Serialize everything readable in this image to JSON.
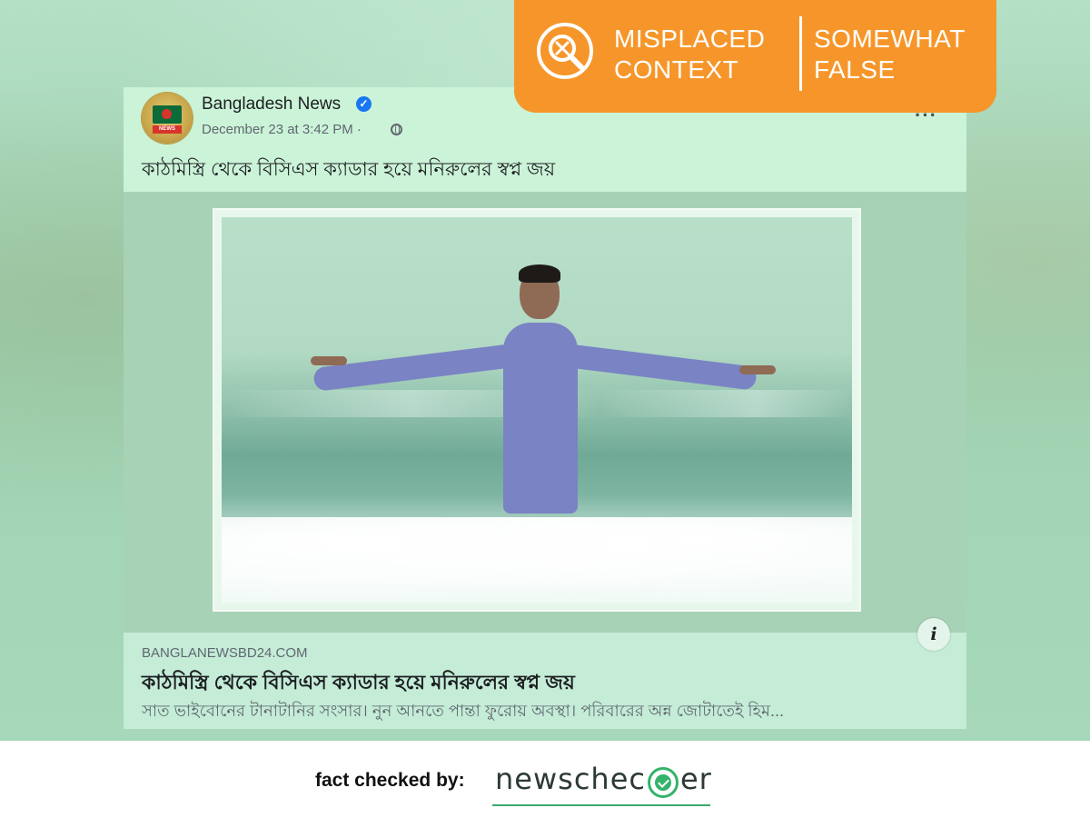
{
  "verdict": {
    "rating_line1": "MISPLACED",
    "rating_line2": "CONTEXT",
    "result_line1": "SOMEWHAT",
    "result_line2": "FALSE",
    "color": "#f6962a",
    "icon": "magnifier-icon"
  },
  "post": {
    "page_name": "Bangladesh News",
    "verified_icon": "verified-check-icon",
    "timestamp": "December 23 at 3:42 PM · ",
    "privacy_icon": "globe-icon",
    "more_label": "···",
    "text": "কাঠমিস্ত্রি থেকে বিসিএস ক্যাডার হয়ে মনিরুলের স্বপ্ন জয়"
  },
  "link_preview": {
    "domain": "BANGLANEWSBD24.COM",
    "title": "কাঠমিস্ত্রি থেকে বিসিএস ক্যাডার হয়ে মনিরুলের স্বপ্ন জয়",
    "description": "সাত ভাইবোনের টানাটানির সংসার। নুন আনতে পান্তা ফুরোয় অবস্থা। পরিবারের অন্ন জোটাতেই হিম...",
    "info_label": "i"
  },
  "footer": {
    "fact_checked_label": "fact checked by:",
    "brand_prefix": "newschec",
    "brand_suffix": "er",
    "brand_color": "#34b36a"
  }
}
